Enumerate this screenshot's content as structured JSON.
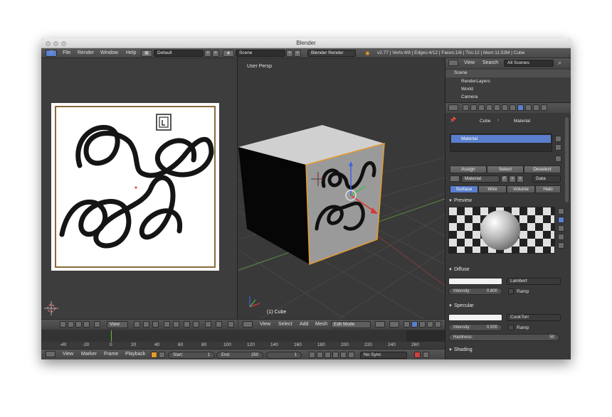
{
  "window": {
    "title": "Blender"
  },
  "topbar": {
    "menus": [
      "File",
      "Render",
      "Window",
      "Help"
    ],
    "layout": "Default",
    "scene": "Scene",
    "engine": "Blender Render",
    "stats": "v2.77 | Verts:4/8 | Edges:4/12 | Faces:1/6 | Tris:12 | Mem:11.53M | Cube"
  },
  "viewport": {
    "label": "User Persp",
    "object": "(1) Cube"
  },
  "uv_header": {
    "view": "View"
  },
  "view3d_header": {
    "menus": [
      "View",
      "Select",
      "Add",
      "Mesh"
    ],
    "mode": "Edit Mode"
  },
  "timeline": {
    "ticks": [
      "-40",
      "-20",
      "0",
      "20",
      "40",
      "60",
      "80",
      "100",
      "120",
      "140",
      "160",
      "180",
      "200",
      "220",
      "240",
      "260"
    ],
    "menus": [
      "View",
      "Marker",
      "Frame",
      "Playback"
    ],
    "start_label": "Start:",
    "start": "1",
    "end_label": "End:",
    "end": "250",
    "current": "1",
    "sync": "No Sync"
  },
  "outliner": {
    "view": "View",
    "search": "Search",
    "filter": "All Scenes",
    "items": [
      "Scene",
      "RenderLayers",
      "World",
      "Camera"
    ]
  },
  "properties": {
    "breadcrumb": [
      "Cube",
      "Material"
    ],
    "slot": "Material",
    "actions": [
      "Assign",
      "Select",
      "Deselect"
    ],
    "material_name": "Material",
    "f_label": "F",
    "link": "Data",
    "tabs": [
      "Surface",
      "Wire",
      "Volume",
      "Halo"
    ],
    "preview_title": "Preview",
    "diffuse": {
      "title": "Diffuse",
      "shader": "Lambert",
      "intensity_label": "Intensity:",
      "intensity": "0.800",
      "ramp": "Ramp"
    },
    "specular": {
      "title": "Specular",
      "shader": "CookTorr",
      "intensity_label": "Intensity:",
      "intensity": "0.500",
      "ramp": "Ramp",
      "hardness_label": "Hardness:",
      "hardness": "50"
    },
    "shading_title": "Shading"
  },
  "colors": {
    "accent": "#5a7fcc",
    "edit_orange": "#e89b2e",
    "window_bg": "#393939"
  }
}
